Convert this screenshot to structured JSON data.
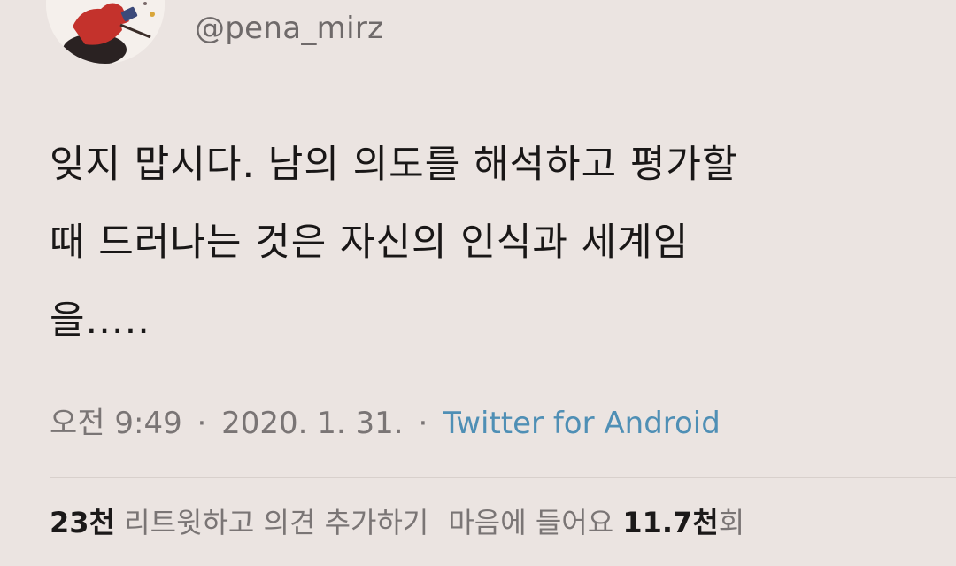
{
  "tweet": {
    "handle": "@pena_mirz",
    "text": "잊지 맙시다. 남의 의도를 해석하고 평가할\n때 드러나는 것은 자신의 인식과 세계임\n을.....",
    "time": "오전 9:49",
    "date": "2020. 1. 31.",
    "source": "Twitter for Android",
    "separator": "·"
  },
  "stats": {
    "retweets_count": "23천",
    "retweets_label": "리트윗하고 의견 추가하기",
    "likes_label": "마음에 들어요",
    "likes_count": "11.7천",
    "likes_suffix": "회"
  },
  "colors": {
    "background": "#ebe4e1",
    "source_link": "#4f8fb5",
    "avatar_red": "#c4322c"
  },
  "icons": {
    "avatar": "profile-avatar-illustration"
  }
}
